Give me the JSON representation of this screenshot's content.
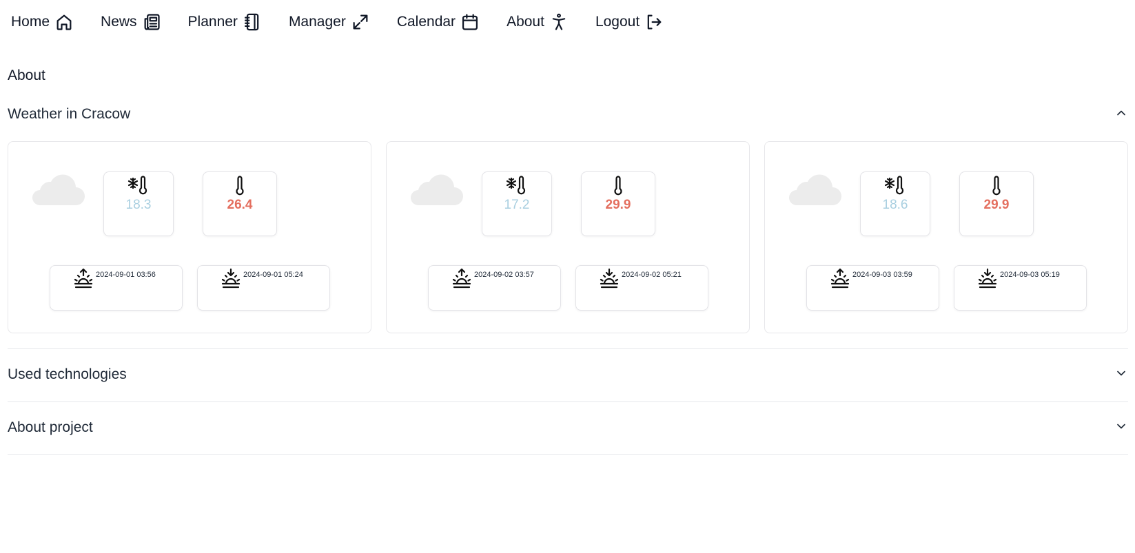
{
  "nav": {
    "items": [
      {
        "label": "Home",
        "icon": "home-icon"
      },
      {
        "label": "News",
        "icon": "newspaper-icon"
      },
      {
        "label": "Planner",
        "icon": "notebook-icon"
      },
      {
        "label": "Manager",
        "icon": "expand-arrows-icon"
      },
      {
        "label": "Calendar",
        "icon": "calendar-icon"
      },
      {
        "label": "About",
        "icon": "accessibility-icon"
      },
      {
        "label": "Logout",
        "icon": "logout-icon"
      }
    ]
  },
  "page": {
    "title": "About"
  },
  "sections": {
    "weather": {
      "title": "Weather in Cracow",
      "expanded": true
    },
    "technologies": {
      "title": "Used technologies",
      "expanded": false
    },
    "project": {
      "title": "About project",
      "expanded": false
    }
  },
  "weather": {
    "days": [
      {
        "condition_icon": "cloud-icon",
        "min_temp": "18.3",
        "max_temp": "26.4",
        "sunrise": "2024-09-01 03:56",
        "sunset": "2024-09-01 05:24"
      },
      {
        "condition_icon": "cloud-icon",
        "min_temp": "17.2",
        "max_temp": "29.9",
        "sunrise": "2024-09-02 03:57",
        "sunset": "2024-09-02 05:21"
      },
      {
        "condition_icon": "cloud-icon",
        "min_temp": "18.6",
        "max_temp": "29.9",
        "sunrise": "2024-09-03 03:59",
        "sunset": "2024-09-03 05:19"
      }
    ]
  },
  "colors": {
    "min_temp": "#a9cfe0",
    "max_temp": "#e46f5f",
    "border": "#e7e7ea",
    "cloud": "#ececec"
  }
}
